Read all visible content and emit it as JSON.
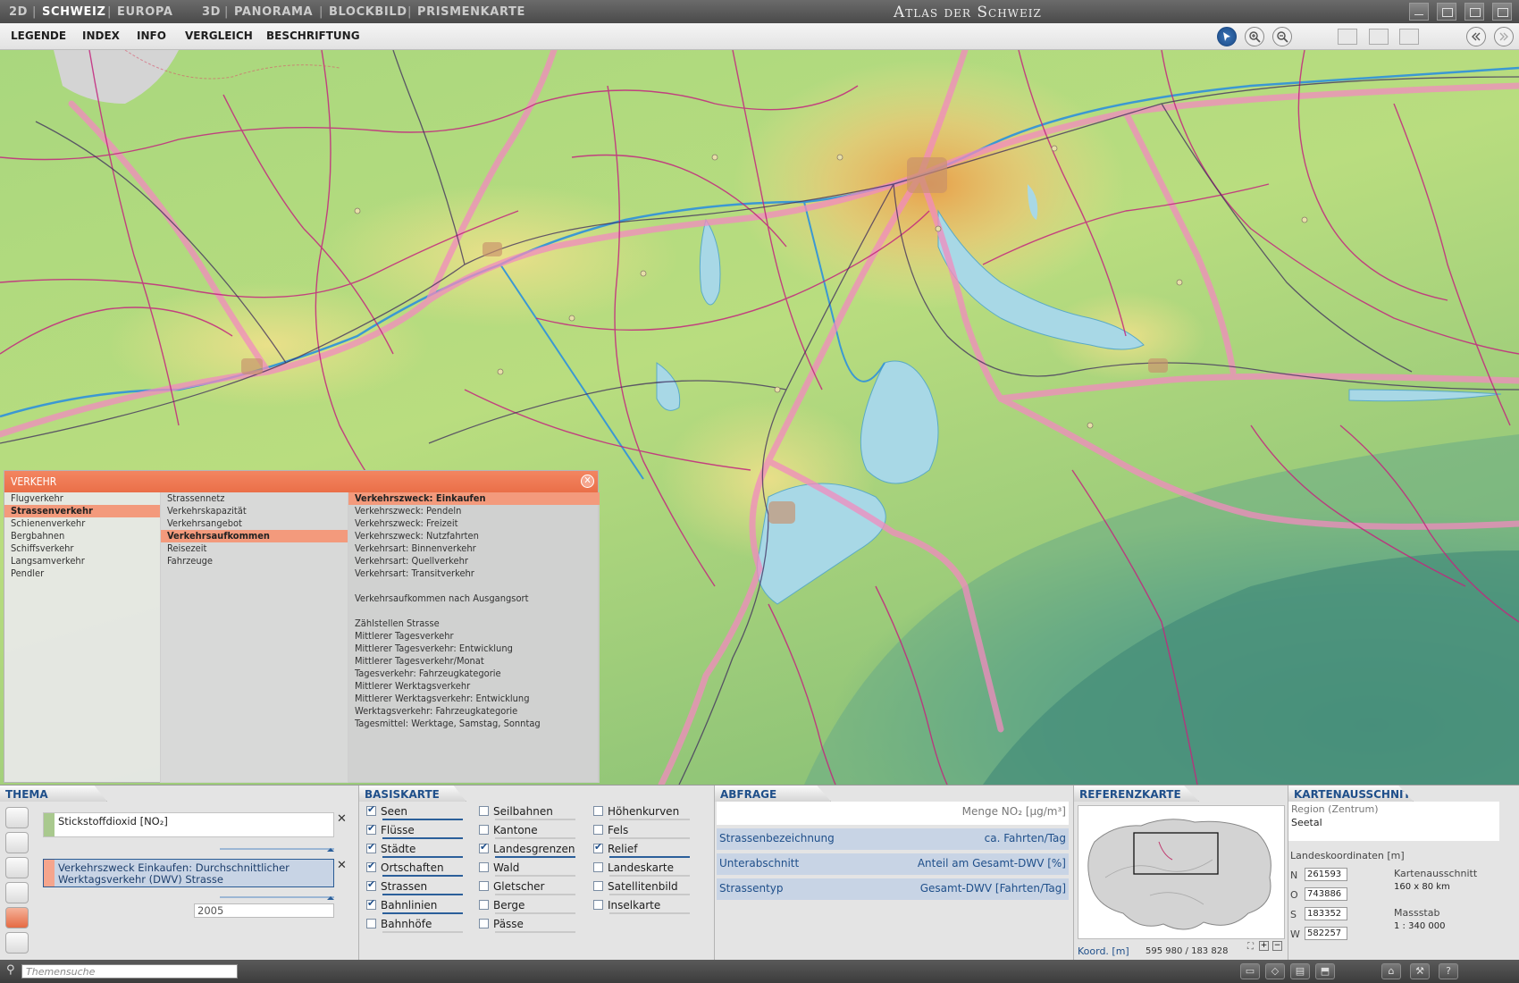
{
  "topbar": {
    "tabs_2d": [
      "2D",
      "SCHWEIZ",
      "EUROPA"
    ],
    "tabs_3d": [
      "3D",
      "PANORAMA",
      "BLOCKBILD",
      "PRISMENKARTE"
    ],
    "title": "Atlas der Schweiz"
  },
  "menu": {
    "items": [
      "LEGENDE",
      "INDEX",
      "INFO",
      "VERGLEICH",
      "BESCHRIFTUNG"
    ]
  },
  "popup": {
    "title": "VERKEHR",
    "col1": [
      "Flugverkehr",
      "Strassenverkehr",
      "Schienenverkehr",
      "Bergbahnen",
      "Schiffsverkehr",
      "Langsamverkehr",
      "Pendler"
    ],
    "col2": [
      "Strassennetz",
      "Verkehrskapazität",
      "Verkehrsangebot",
      "Verkehrsaufkommen",
      "Reisezeit",
      "Fahrzeuge"
    ],
    "col3": [
      "Verkehrszweck: Einkaufen",
      "Verkehrszweck: Pendeln",
      "Verkehrszweck: Freizeit",
      "Verkehrszweck: Nutzfahrten",
      "Verkehrsart: Binnenverkehr",
      "Verkehrsart: Quellverkehr",
      "Verkehrsart: Transitverkehr",
      "",
      "Verkehrsaufkommen nach Ausgangsort",
      "",
      "Zählstellen Strasse",
      "Mittlerer Tagesverkehr",
      "Mittlerer Tagesverkehr: Entwicklung",
      "Mittlerer Tagesverkehr/Monat",
      "Tagesverkehr: Fahrzeugkategorie",
      "Mittlerer Werktagsverkehr",
      "Mittlerer Werktagsverkehr: Entwicklung",
      "Werktagsverkehr: Fahrzeugkategorie",
      "Tagesmittel: Werktage, Samstag, Sonntag"
    ]
  },
  "thema": {
    "title": "THEMA",
    "layer1": "Stickstoffdioxid [NO₂]",
    "layer2": "Verkehrszweck Einkaufen: Durchschnittlicher Werktagsverkehr (DWV) Strasse",
    "year": "2005"
  },
  "basiskarte": {
    "title": "BASISKARTE",
    "col1": [
      {
        "label": "Seen",
        "checked": true
      },
      {
        "label": "Flüsse",
        "checked": true
      },
      {
        "label": "Städte",
        "checked": true
      },
      {
        "label": "Ortschaften",
        "checked": true
      },
      {
        "label": "Strassen",
        "checked": true
      },
      {
        "label": "Bahnlinien",
        "checked": true
      },
      {
        "label": "Bahnhöfe",
        "checked": false
      }
    ],
    "col2": [
      {
        "label": "Seilbahnen",
        "checked": false
      },
      {
        "label": "Kantone",
        "checked": false
      },
      {
        "label": "Landesgrenzen",
        "checked": true
      },
      {
        "label": "Wald",
        "checked": false
      },
      {
        "label": "Gletscher",
        "checked": false
      },
      {
        "label": "Berge",
        "checked": false
      },
      {
        "label": "Pässe",
        "checked": false
      }
    ],
    "col3": [
      {
        "label": "Höhenkurven",
        "checked": false
      },
      {
        "label": "Fels",
        "checked": false
      },
      {
        "label": "Relief",
        "checked": true
      },
      {
        "label": "Landeskarte",
        "checked": false
      },
      {
        "label": "Satellitenbild",
        "checked": false
      },
      {
        "label": "Inselkarte",
        "checked": false
      }
    ]
  },
  "abfrage": {
    "title": "ABFRAGE",
    "header_right": "Menge NO₂ [µg/m³]",
    "rows": [
      {
        "left": "Strassenbezeichnung",
        "right": "ca. Fahrten/Tag"
      },
      {
        "left": "Unterabschnitt",
        "right": "Anteil am Gesamt-DWV [%]"
      },
      {
        "left": "Strassentyp",
        "right": "Gesamt-DWV [Fahrten/Tag]"
      }
    ]
  },
  "referenz": {
    "title": "REFERENZKARTE",
    "coord_label": "Koord. [m]",
    "coord_value": "595 980 / 183 828"
  },
  "ausschnitt": {
    "title": "KARTENAUSSCHNITT",
    "region_label": "Region (Zentrum)",
    "region_value": "Seetal",
    "coords_label": "Landeskoordinaten [m]",
    "n_label": "N",
    "n_value": "261593",
    "o_label": "O",
    "o_value": "743886",
    "s_label": "S",
    "s_value": "183352",
    "w_label": "W",
    "w_value": "582257",
    "size_label": "Kartenausschnitt",
    "size_value": "160 x 80 km",
    "scale_label": "Massstab",
    "scale_value": "1 : 340 000"
  },
  "status": {
    "search_placeholder": "Themensuche"
  }
}
